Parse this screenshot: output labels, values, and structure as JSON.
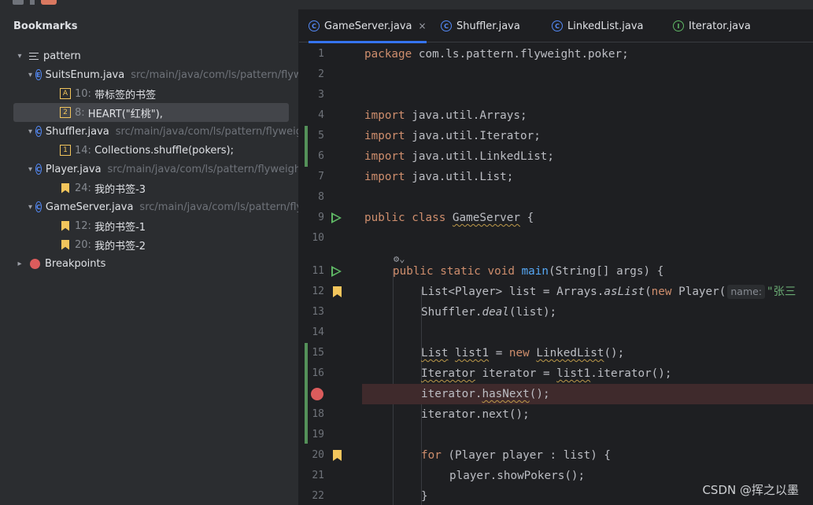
{
  "panel": {
    "title": "Bookmarks"
  },
  "tree": {
    "package": "pattern",
    "files": [
      {
        "name": "SuitsEnum.java",
        "path": "src/main/java/com/ls/pattern/flyweight/poker",
        "entries": [
          {
            "mnemonic": "A",
            "line": "10:",
            "text": "带标签的书签"
          },
          {
            "mnemonic": "2",
            "line": "8:",
            "text": "HEART(\"红桃\"),"
          }
        ]
      },
      {
        "name": "Shuffler.java",
        "path": "src/main/java/com/ls/pattern/flyweight/poker",
        "entries": [
          {
            "mnemonic": "1",
            "line": "14:",
            "text": "Collections.shuffle(pokers);"
          }
        ]
      },
      {
        "name": "Player.java",
        "path": "src/main/java/com/ls/pattern/flyweight/poker",
        "entries": [
          {
            "line": "24:",
            "text": "我的书签-3"
          }
        ]
      },
      {
        "name": "GameServer.java",
        "path": "src/main/java/com/ls/pattern/flyweight/poker",
        "entries": [
          {
            "line": "12:",
            "text": "我的书签-1"
          },
          {
            "line": "20:",
            "text": "我的书签-2"
          }
        ]
      }
    ],
    "breakpoints": "Breakpoints"
  },
  "tabs": [
    {
      "label": "GameServer.java",
      "icon": "class-icon",
      "active": true
    },
    {
      "label": "Shuffler.java",
      "icon": "class-icon"
    },
    {
      "label": "LinkedList.java",
      "icon": "class-icon"
    },
    {
      "label": "Iterator.java",
      "icon": "interface-icon"
    }
  ],
  "editor": {
    "line_numbers": [
      "1",
      "2",
      "3",
      "4",
      "5",
      "6",
      "7",
      "8",
      "9",
      "10",
      "11",
      "12",
      "13",
      "14",
      "15",
      "16",
      "17",
      "18",
      "19",
      "20",
      "21",
      "22"
    ],
    "code": {
      "pkg_kw": "package",
      "pkg_name": " com.ls.pattern.flyweight.poker;",
      "import_kw": "import",
      "imports": [
        " java.util.Arrays;",
        " java.util.Iterator;",
        " java.util.LinkedList;",
        " java.util.List;"
      ],
      "public": "public",
      "class": "class",
      "class_name": "GameServer",
      "brace_open": " {",
      "static": "static",
      "void": "void",
      "main": "main",
      "main_args": "(String[] args) {",
      "l12_a": "List<Player> list = Arrays.",
      "l12_b": "asList",
      "l12_c": "(",
      "new": "new",
      "l12_d": " Player(",
      "hint_name": "name:",
      "l12_str": "\"张三",
      "l13_a": "Shuffler.",
      "l13_b": "deal",
      "l13_c": "(list);",
      "l15_a": "List",
      "l15_b": "list1",
      "l15_c": " = ",
      "l15_d": "LinkedList",
      "l15_e": "();",
      "l16_a": "Iterator",
      "l16_b": " iterator = ",
      "l16_c": "list1",
      "l16_d": ".iterator();",
      "l17_a": "iterator.",
      "l17_b": "hasNext",
      "l17_c": "();",
      "l18": "iterator.next();",
      "for": "for",
      "l20": " (Player player : list) {",
      "l21": "player.showPokers();",
      "l22": "}"
    },
    "lens": "⚙︎⌄"
  },
  "watermark": "CSDN @挥之以墨",
  "colors": {
    "accent": "#3574f0",
    "bookmark": "#f2c55c",
    "breakpoint": "#db5c5c",
    "change": "#549159"
  }
}
